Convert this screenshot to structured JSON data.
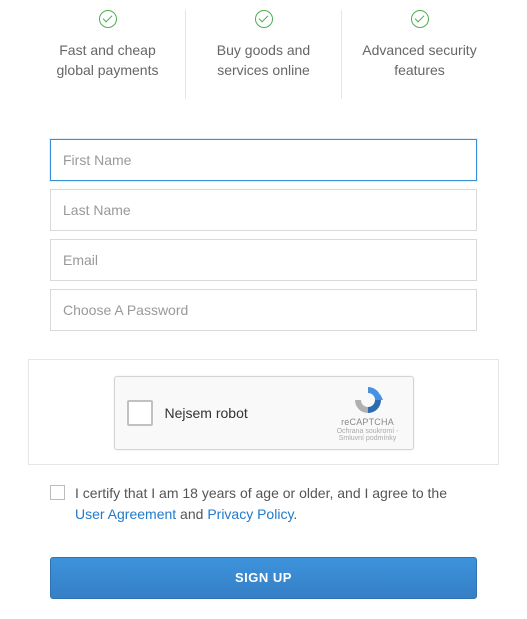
{
  "features": [
    {
      "text": "Fast and cheap global payments"
    },
    {
      "text": "Buy goods and services online"
    },
    {
      "text": "Advanced security features"
    }
  ],
  "form": {
    "first_name_placeholder": "First Name",
    "last_name_placeholder": "Last Name",
    "email_placeholder": "Email",
    "password_placeholder": "Choose A Password"
  },
  "captcha": {
    "label": "Nejsem robot",
    "brand": "reCAPTCHA",
    "sub": "Ochrana soukromí - Smluvní podmínky"
  },
  "consent": {
    "prefix": "I certify that I am 18 years of age or older, and I agree to the ",
    "link1": "User Agreement",
    "mid": " and ",
    "link2": "Privacy Policy",
    "suffix": "."
  },
  "submit_label": "SIGN UP"
}
